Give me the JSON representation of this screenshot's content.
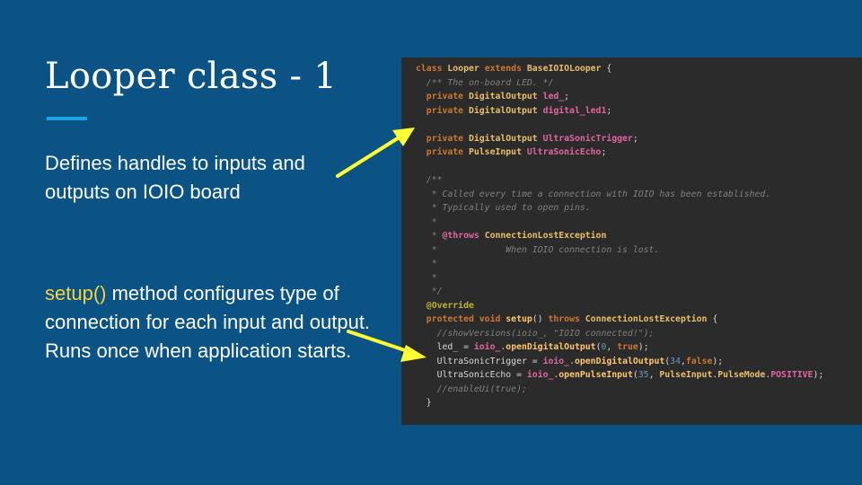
{
  "slide": {
    "title": "Looper class - 1",
    "para1": "Defines handles to inputs and outputs on IOIO board",
    "para2_highlight": "setup()",
    "para2_rest": " method configures type of connection for each input and output. Runs once when application starts.",
    "accent_color": "#1ea3e4",
    "highlight_color": "#f6d23f",
    "arrow_color": "#ffff33"
  },
  "code": {
    "l1": [
      {
        "t": "class ",
        "c": "kw"
      },
      {
        "t": "Looper ",
        "c": "typ"
      },
      {
        "t": "extends ",
        "c": "kw"
      },
      {
        "t": "BaseIOIOLooper",
        "c": "typ"
      },
      {
        "t": " {",
        "c": "pln"
      }
    ],
    "l2": [
      {
        "t": "  /** The on-board LED. */",
        "c": "cm"
      }
    ],
    "l3": [
      {
        "t": "  private ",
        "c": "kw"
      },
      {
        "t": "DigitalOutput ",
        "c": "typ"
      },
      {
        "t": "led_",
        "c": "fld"
      },
      {
        "t": ";",
        "c": "pln"
      }
    ],
    "l4": [
      {
        "t": "  private ",
        "c": "kw"
      },
      {
        "t": "DigitalOutput ",
        "c": "typ"
      },
      {
        "t": "digital_led1",
        "c": "fld"
      },
      {
        "t": ";",
        "c": "pln"
      }
    ],
    "l5": [
      {
        "t": "",
        "c": "pln"
      }
    ],
    "l6": [
      {
        "t": "  private ",
        "c": "kw"
      },
      {
        "t": "DigitalOutput ",
        "c": "typ"
      },
      {
        "t": "UltraSonicTrigger",
        "c": "fld"
      },
      {
        "t": ";",
        "c": "pln"
      }
    ],
    "l7": [
      {
        "t": "  private ",
        "c": "kw"
      },
      {
        "t": "PulseInput ",
        "c": "typ"
      },
      {
        "t": "UltraSonicEcho",
        "c": "fld"
      },
      {
        "t": ";",
        "c": "pln"
      }
    ],
    "l8": [
      {
        "t": "",
        "c": "pln"
      }
    ],
    "l9": [
      {
        "t": "  /**",
        "c": "cm"
      }
    ],
    "l10": [
      {
        "t": "   * Called every time a connection with IOIO has been established.",
        "c": "cm"
      }
    ],
    "l11": [
      {
        "t": "   * Typically used to open pins.",
        "c": "cm"
      }
    ],
    "l12": [
      {
        "t": "   *",
        "c": "cm"
      }
    ],
    "l13": [
      {
        "t": "   * ",
        "c": "cm"
      },
      {
        "t": "@throws ",
        "c": "fld"
      },
      {
        "t": "ConnectionLostException",
        "c": "exc"
      }
    ],
    "l14": [
      {
        "t": "   *             When IOIO connection is lost.",
        "c": "cm"
      }
    ],
    "l15": [
      {
        "t": "   *",
        "c": "cm"
      }
    ],
    "l16": [
      {
        "t": "   *",
        "c": "cm"
      }
    ],
    "l17": [
      {
        "t": "   */",
        "c": "cm"
      }
    ],
    "l18": [
      {
        "t": "  @Override",
        "c": "ann"
      }
    ],
    "l19": [
      {
        "t": "  protected ",
        "c": "kw"
      },
      {
        "t": "void ",
        "c": "kw"
      },
      {
        "t": "setup",
        "c": "met"
      },
      {
        "t": "() ",
        "c": "pln"
      },
      {
        "t": "throws ",
        "c": "kw"
      },
      {
        "t": "ConnectionLostException",
        "c": "exc"
      },
      {
        "t": " {",
        "c": "pln"
      }
    ],
    "l20": [
      {
        "t": "    //showVersions(ioio_, \"IOIO connected!\");",
        "c": "cm"
      }
    ],
    "l21": [
      {
        "t": "    led_",
        "c": "pln"
      },
      {
        "t": " = ",
        "c": "pln"
      },
      {
        "t": "ioio_",
        "c": "fld"
      },
      {
        "t": ".",
        "c": "pln"
      },
      {
        "t": "openDigitalOutput",
        "c": "met"
      },
      {
        "t": "(",
        "c": "pln"
      },
      {
        "t": "0",
        "c": "num"
      },
      {
        "t": ", ",
        "c": "pln"
      },
      {
        "t": "true",
        "c": "kw"
      },
      {
        "t": ");",
        "c": "pln"
      }
    ],
    "l22": [
      {
        "t": "    UltraSonicTrigger",
        "c": "pln"
      },
      {
        "t": " = ",
        "c": "pln"
      },
      {
        "t": "ioio_",
        "c": "fld"
      },
      {
        "t": ".",
        "c": "pln"
      },
      {
        "t": "openDigitalOutput",
        "c": "met"
      },
      {
        "t": "(",
        "c": "pln"
      },
      {
        "t": "34",
        "c": "num"
      },
      {
        "t": ",",
        "c": "pln"
      },
      {
        "t": "false",
        "c": "kw"
      },
      {
        "t": ");",
        "c": "pln"
      }
    ],
    "l23": [
      {
        "t": "    UltraSonicEcho",
        "c": "pln"
      },
      {
        "t": " = ",
        "c": "pln"
      },
      {
        "t": "ioio_",
        "c": "fld"
      },
      {
        "t": ".",
        "c": "pln"
      },
      {
        "t": "openPulseInput",
        "c": "met"
      },
      {
        "t": "(",
        "c": "pln"
      },
      {
        "t": "35",
        "c": "num"
      },
      {
        "t": ", ",
        "c": "pln"
      },
      {
        "t": "PulseInput",
        "c": "typ"
      },
      {
        "t": ".",
        "c": "pln"
      },
      {
        "t": "PulseMode",
        "c": "typ"
      },
      {
        "t": ".",
        "c": "pln"
      },
      {
        "t": "POSITIVE",
        "c": "fld"
      },
      {
        "t": ");",
        "c": "pln"
      }
    ],
    "l24": [
      {
        "t": "    //enableUi(true);",
        "c": "cm"
      }
    ],
    "l25": [
      {
        "t": "  }",
        "c": "pln"
      }
    ]
  }
}
